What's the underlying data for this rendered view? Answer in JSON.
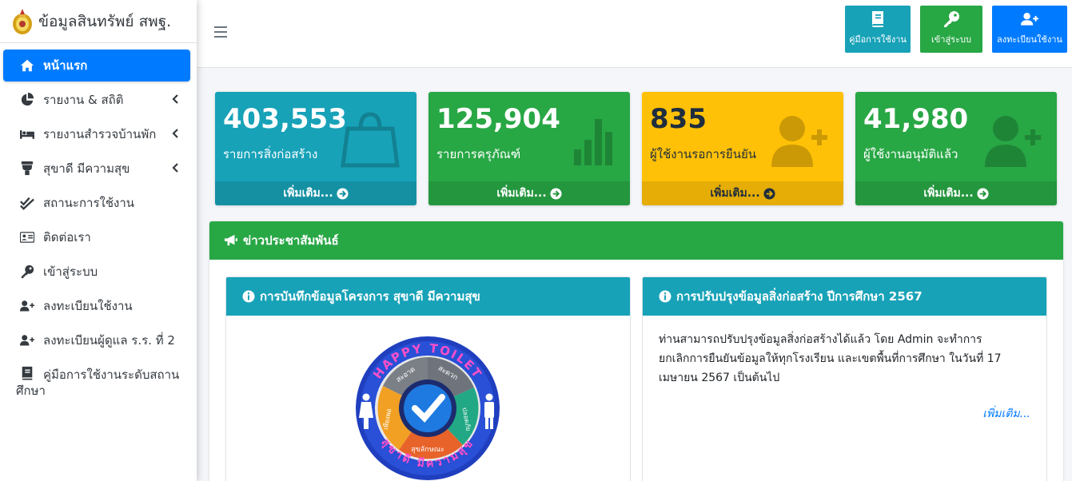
{
  "brand": {
    "title": "ข้อมูลสินทรัพย์ สพฐ."
  },
  "sidebar": {
    "items": [
      {
        "label": "หน้าแรก",
        "icon": "home-icon",
        "active": true
      },
      {
        "label": "รายงาน & สถิติ",
        "icon": "chart-pie-icon"
      },
      {
        "label": "รายงานสำรวจบ้านพัก",
        "icon": "bed-icon"
      },
      {
        "label": "สุขาดี มีความสุข",
        "icon": "toilet-icon"
      },
      {
        "label": "สถานะการใช้งาน",
        "icon": "check-double-icon"
      },
      {
        "label": "ติดต่อเรา",
        "icon": "address-card-icon"
      },
      {
        "label": "เข้าสู่ระบบ",
        "icon": "key-icon"
      },
      {
        "label": "ลงทะเบียนใช้งาน",
        "icon": "user-plus-icon"
      },
      {
        "label": "ลงทะเบียนผู้ดูแล ร.ร. ที่ 2",
        "icon": "user-plus-icon"
      },
      {
        "label": "คู่มือการใช้งานระดับสถาน",
        "label_line2": "ศึกษา",
        "icon": "book-icon"
      }
    ]
  },
  "header": {
    "manual_label": "คู่มือการใช้งาน",
    "login_label": "เข้าสู่ระบบ",
    "register_label": "ลงทะเบียนใช้งาน"
  },
  "stats": [
    {
      "value": "403,553",
      "label": "รายการสิ่งก่อสร้าง",
      "more": "เพิ่มเติม...",
      "color": "#17a2b8",
      "icon": "shopping-bag-icon"
    },
    {
      "value": "125,904",
      "label": "รายการครุภัณฑ์",
      "more": "เพิ่มเติม...",
      "color": "#28a745",
      "icon": "bar-chart-icon"
    },
    {
      "value": "835",
      "label": "ผู้ใช้งานรอการยืนยัน",
      "more": "เพิ่มเติม...",
      "color": "#ffc107",
      "icon": "user-plus-icon"
    },
    {
      "value": "41,980",
      "label": "ผู้ใช้งานอนุมัติแล้ว",
      "more": "เพิ่มเติม...",
      "color": "#28a745",
      "icon": "user-plus-icon"
    }
  ],
  "news": {
    "title": "ข่าวประชาสัมพันธ์",
    "panel1": {
      "title": "การบันทึกข้อมูลโครงการ สุขาดี มีความสุข",
      "logo": {
        "top_text": "HAPPY TOILET",
        "bottom_text": "สุขาดี มีความสุข",
        "segments": [
          "สะอาด",
          "สะดวก",
          "ปลอดภัย",
          "เพียงพอ",
          "สุขลักษณะ"
        ]
      }
    },
    "panel2": {
      "title": "การปรับปรุงข้อมูลสิ่งก่อสร้าง ปีการศึกษา 2567",
      "body_line1": "ท่านสามารถปรับปรุงข้อมูลสิ่งก่อสร้างได้แล้ว โดย Admin จะทำการ",
      "body_line2": "ยกเลิกการยืนยันข้อมูลให้ทุกโรงเรียน และเขตพื้นที่การศึกษา ในวันที่ 17",
      "body_line3": "เมษายน 2567 เป็นต้นไป",
      "more": "เพิ่มเติม..."
    }
  },
  "colors": {
    "primary": "#007bff",
    "info": "#17a2b8",
    "success": "#28a745",
    "warning": "#ffc107"
  }
}
